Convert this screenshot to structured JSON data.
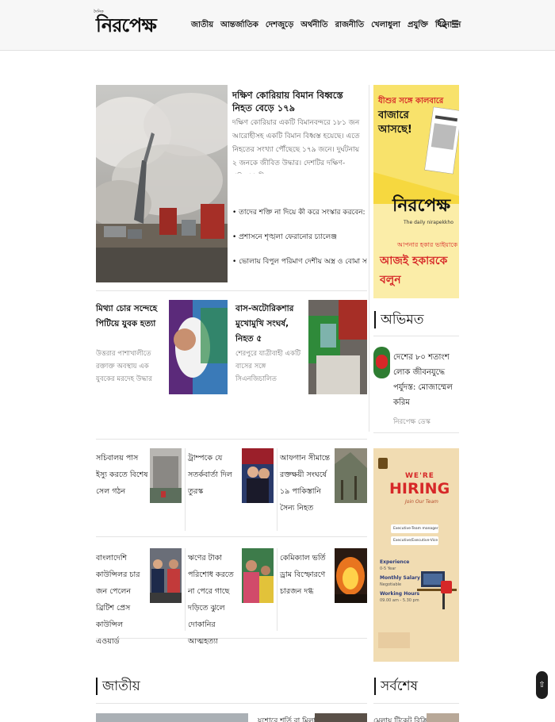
{
  "header": {
    "logo_tag": "দৈনিক",
    "logo": "নিরপেক্ষ",
    "nav": [
      "জাতীয়",
      "আন্তর্জাতিক",
      "দেশজুড়ে",
      "অর্থনীতি",
      "রাজনীতি",
      "খেলাধুলা",
      "প্রযুক্তি",
      "বিনোদন"
    ]
  },
  "lead": {
    "title": "দক্ষিণ কোরিয়ায় বিমান বিধ্বস্তে নিহত বেড়ে ১৭৯",
    "summary": "দক্ষিণ কোরিয়ার একটি বিমানবন্দরে ১৮১ জন আরোহীসহ একটি বিমান বিধ্বস্ত হয়েছে। এতে নিহতের সংখ্যা পৌঁছেছে ১৭৯ জনে। দুর্ঘটনায় ২ জনকে জীবিত উদ্ধার। দেশটির দক্ষিণ-পশ্চিমাঞ্চলীয়...",
    "bullets": [
      "• তাদের শক্তি না দিয়ে কী করে সংস্কার করবেন: সারজিস",
      "• প্রশাসনে শৃঙ্খলা ফেরানোর চ্যালেঞ্জ",
      "• ভোলায় বিপুল পরিমাণ দেশীয় অস্ত্র ও বোমা সহ ৬ সন্ত্রাসী আটক"
    ]
  },
  "secondary": [
    {
      "title": "মিথ্যা চোর সন্দেহে পিটিয়ে যুবক হত্যা",
      "summary": "উত্তরার পাশাখালীতে রক্তাক্ত অবস্থায় এক যুবকের মরদেহ উদ্ধার করেছে পুলিশ..."
    },
    {
      "title": "বাস-অটোরিকশার মুখোমুখি সংঘর্ষ, নিহত ৫",
      "summary": "শেরপুরে যাত্রীবাহী একটি বাসের সঙ্গে সিএনজিচালিত অটোরিকশার মুখোমুখি..."
    }
  ],
  "opinion": {
    "heading": "অভিমত",
    "title": "দেশের ৮০ শতাংশ লোক জীবনযুদ্ধে পর্যুদস্ত: মোজাম্মেল করিম",
    "author": "নিরপেক্ষ ডেস্ক"
  },
  "grid": [
    "সচিবালয় পাস ইস্যু করতে বিশেষ সেল গঠন",
    "ট্রাম্পকে যে সতর্কবার্তা দিল তুরস্ক",
    "আফগান সীমান্তে রক্তক্ষয়ী সংঘর্ষে ১৯ পাকিস্তানি সৈন্য নিহত",
    "বাংলাদেশি কাউন্সিলর চার জন পেলেন ব্রিটিশ প্রেস কাউন্সিল এওয়ার্ড",
    "ঋণের টাকা পরিশোধ করতে না পেরে গাছে দড়িতে ঝুলে দোকানির আত্মহত্যা",
    "কেমিক্যাল ভর্তি ড্রাম বিস্ফোরণে চারজন দগ্ধ"
  ],
  "ad1": {
    "headline_1": "যীশুর সঙ্গে কালবারে",
    "headline_2": "বাজারে আসছে!",
    "logo": "নিরপেক্ষ",
    "tagline": "The daily nirapekkho",
    "cta_1": "আপনার হকার ভাইয়াকে",
    "cta_2": "আজই হকারকে বলুন"
  },
  "ad2": {
    "title_1": "WE'RE",
    "title_2": "HIRING",
    "sub": "Join Our Team",
    "items": [
      "Executive-Team manager",
      "Executive/Executive-Vice Presence"
    ],
    "exp_label": "Experience",
    "exp": "0-5 Year",
    "salary_label": "Monthly Salary",
    "salary": "Negotiable",
    "hours_label": "Working Hours",
    "hours": "09.00 am - 5.30 pm"
  },
  "sections": {
    "national": "জাতীয়",
    "latest": "সর্বশেষ"
  },
  "peek": {
    "national_title": "যশোরে শর্তি বা মিলা নাই",
    "latest_title": "মেলায় টিকেট বিক্রি"
  },
  "colors": {
    "accent": "#d62828",
    "ad_yellow": "#f6d83f",
    "ad_hiring": "#f1dcb2"
  }
}
